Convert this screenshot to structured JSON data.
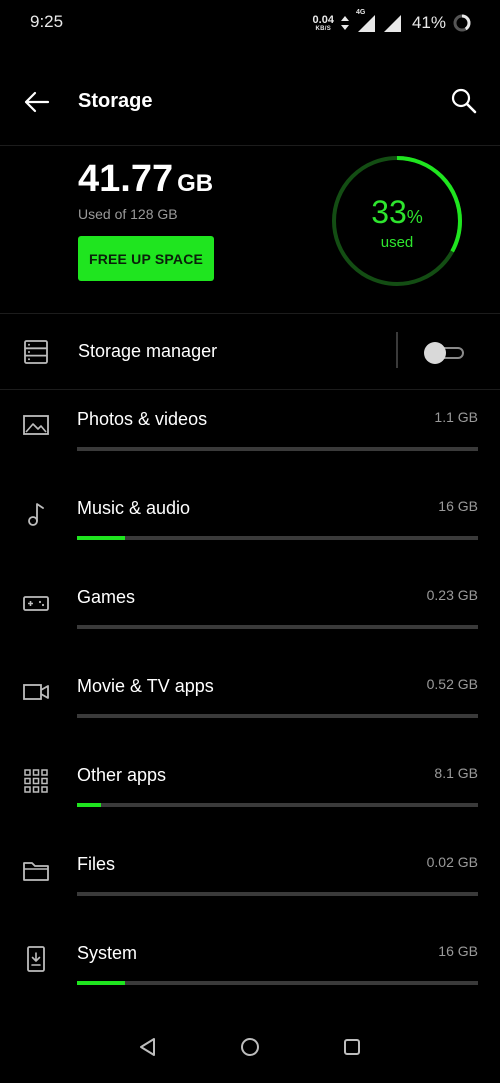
{
  "status_bar": {
    "time": "9:25",
    "net_speed_value": "0.04",
    "net_speed_unit": "KB/S",
    "network_type": "4G",
    "battery": "41%"
  },
  "header": {
    "title": "Storage",
    "back_icon": "arrow-left-icon",
    "search_icon": "search-icon"
  },
  "summary": {
    "used_value": "41.77",
    "used_unit": "GB",
    "used_of": "Used of 128 GB",
    "free_up_label": "FREE UP SPACE",
    "percent_value": "33",
    "percent_sign": "%",
    "percent_label": "used",
    "used_fraction": 0.33
  },
  "storage_manager": {
    "label": "Storage manager",
    "enabled": false,
    "icon": "server-icon"
  },
  "categories": [
    {
      "label": "Photos & videos",
      "size": "1.1 GB",
      "fraction": 0.0,
      "icon": "image-icon"
    },
    {
      "label": "Music & audio",
      "size": "16 GB",
      "fraction": 0.12,
      "icon": "music-note-icon"
    },
    {
      "label": "Games",
      "size": "0.23 GB",
      "fraction": 0.0,
      "icon": "gamepad-icon"
    },
    {
      "label": "Movie & TV apps",
      "size": "0.52 GB",
      "fraction": 0.0,
      "icon": "video-camera-icon"
    },
    {
      "label": "Other apps",
      "size": "8.1 GB",
      "fraction": 0.06,
      "icon": "apps-grid-icon"
    },
    {
      "label": "Files",
      "size": "0.02 GB",
      "fraction": 0.0,
      "icon": "folder-icon"
    },
    {
      "label": "System",
      "size": "16 GB",
      "fraction": 0.12,
      "icon": "phone-download-icon"
    }
  ],
  "colors": {
    "accent": "#1fe51f",
    "accent_text": "#2ee52e",
    "background": "#000000",
    "track": "#3a3a3a",
    "secondary_text": "#9a9a9a"
  },
  "nav_bar": {
    "back_icon": "nav-back-icon",
    "home_icon": "nav-home-icon",
    "recents_icon": "nav-recents-icon"
  }
}
